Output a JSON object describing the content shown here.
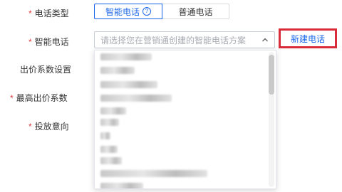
{
  "form": {
    "call_type": {
      "required": "*",
      "label": "电话类型",
      "options": [
        {
          "label": "智能电话",
          "selected": true,
          "help_icon": "question-circle-icon",
          "help_glyph": "?"
        },
        {
          "label": "普通电话",
          "selected": false
        }
      ]
    },
    "smart_call": {
      "required": "*",
      "label": "智能电话",
      "select_placeholder": "请选择您在营销通创建的智能电话方案",
      "dropdown_icon": "chevron-up-icon",
      "new_button": "新建电话"
    },
    "bid_coefficient": {
      "label": "出价系数设置"
    },
    "max_bid_coefficient": {
      "required": "*",
      "label": "最高出价系数"
    },
    "intent": {
      "required": "*",
      "label": "投放意向"
    }
  },
  "colors": {
    "accent": "#1a66e8",
    "required": "#e0383e",
    "highlight_border": "#d92c3a",
    "text": "#333333",
    "placeholder": "#a8abb2"
  }
}
